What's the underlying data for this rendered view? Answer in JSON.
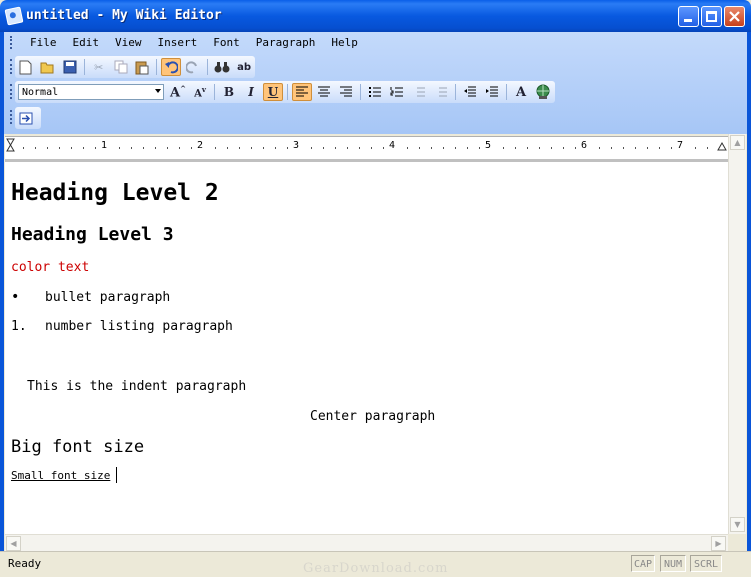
{
  "window": {
    "title": "untitled - My Wiki Editor"
  },
  "menu": {
    "items": [
      "File",
      "Edit",
      "View",
      "Insert",
      "Font",
      "Paragraph",
      "Help"
    ]
  },
  "toolbar": {
    "style_value": "Normal",
    "bold_label": "B",
    "italic_label": "I",
    "underline_label": "U",
    "font_color_label": "A"
  },
  "ruler": {
    "marks": [
      "1",
      "2",
      "3",
      "4",
      "5",
      "6",
      "7"
    ]
  },
  "document": {
    "h2": "Heading Level 2",
    "h3": "Heading Level 3",
    "color_text": "color text",
    "bullet_marker": "•",
    "bullet_text": "bullet paragraph",
    "number_marker": "1.",
    "number_text": "number listing paragraph",
    "indent_text": "This is the indent paragraph",
    "center_text": "Center paragraph",
    "big_text": "Big font size",
    "small_text": "Small font size"
  },
  "status": {
    "text": "Ready",
    "cap": "CAP",
    "num": "NUM",
    "scrl": "SCRL"
  },
  "watermark": "GearDownload.com",
  "colors": {
    "title_bar": "#0a5fe8",
    "color_text": "#cc0000",
    "toolbar_band": "#c4dafb"
  }
}
